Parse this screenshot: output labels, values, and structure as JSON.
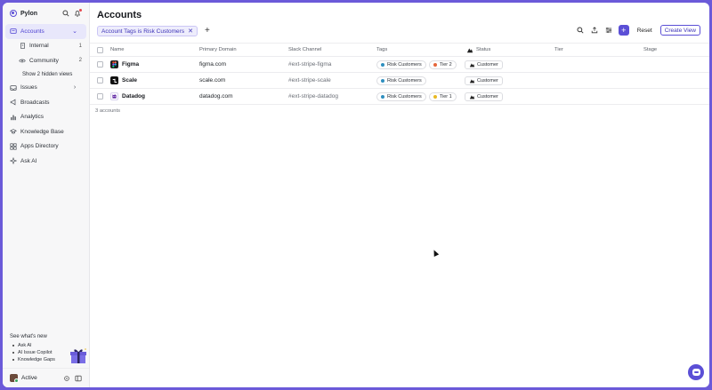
{
  "sidebar": {
    "brand": "Pylon",
    "nav": {
      "accounts": "Accounts",
      "internal": "Internal",
      "internal_count": "1",
      "community": "Community",
      "community_count": "2",
      "hidden_views": "Show 2 hidden views",
      "issues": "Issues",
      "broadcasts": "Broadcasts",
      "analytics": "Analytics",
      "knowledge_base": "Knowledge Base",
      "apps_directory": "Apps Directory",
      "ask_ai": "Ask AI"
    },
    "whats_new": {
      "title": "See what's new",
      "items": [
        "Ask AI",
        "AI Issue Copilot",
        "Knowledge Gaps"
      ]
    },
    "footer": {
      "status": "Active"
    }
  },
  "main": {
    "title": "Accounts",
    "filter": {
      "label": "Account Tags is Risk Customers"
    },
    "toolbar": {
      "reset": "Reset",
      "create_view": "Create View"
    },
    "table": {
      "columns": {
        "name": "Name",
        "domain": "Primary Domain",
        "slack": "Slack Channel",
        "tags": "Tags",
        "status": "Status",
        "tier": "Tier",
        "stage": "Stage"
      },
      "rows": [
        {
          "name": "Figma",
          "domain": "figma.com",
          "slack": "#ext-stripe-figma",
          "tag1": "Risk Customers",
          "tag2": "Tier 2",
          "status": "Customer"
        },
        {
          "name": "Scale",
          "domain": "scale.com",
          "slack": "#ext-stripe-scale",
          "tag1": "Risk Customers",
          "status": "Customer"
        },
        {
          "name": "Datadog",
          "domain": "datadog.com",
          "slack": "#ext-stripe-datadog",
          "tag1": "Risk Customers",
          "tag2": "Tier 1",
          "status": "Customer"
        }
      ],
      "count": "3 accounts"
    }
  },
  "colors": {
    "accent": "#5b4fd6",
    "risk_tag": "#2f8fbf",
    "tier2_tag": "#e5663a",
    "tier1_tag": "#e8b923",
    "figma_logo": "#1e1e1e",
    "scale_logo": "#111111",
    "datadog_logo": "#632ca6"
  }
}
